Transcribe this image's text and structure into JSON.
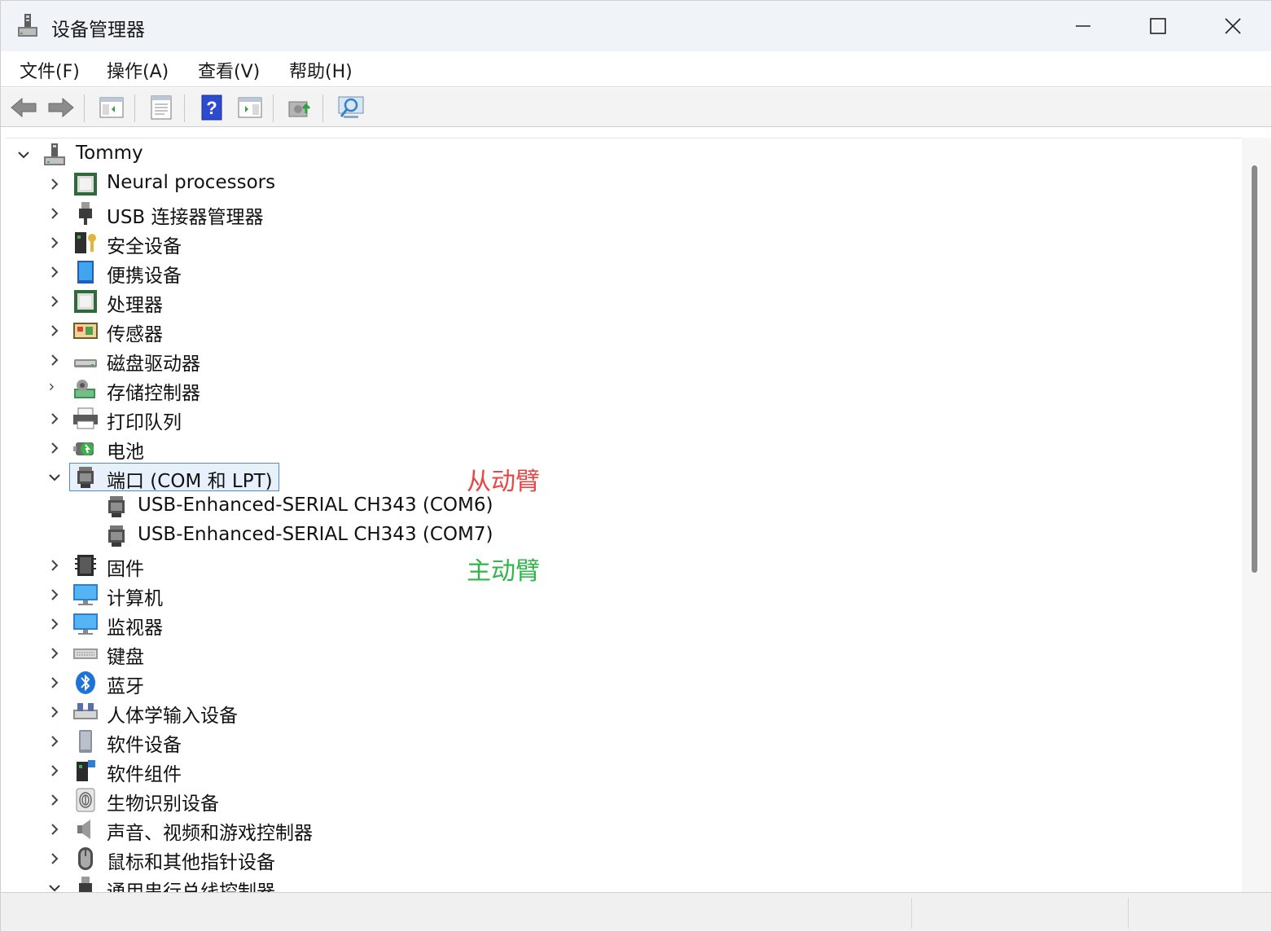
{
  "window": {
    "title": "设备管理器",
    "icon": "device-manager-icon"
  },
  "menu": [
    {
      "label": "文件(F)"
    },
    {
      "label": "操作(A)"
    },
    {
      "label": "查看(V)"
    },
    {
      "label": "帮助(H)"
    }
  ],
  "toolbar": [
    {
      "name": "back-icon"
    },
    {
      "name": "forward-icon"
    },
    {
      "name": "show-hide-console-tree-icon"
    },
    {
      "name": "properties-icon"
    },
    {
      "name": "help-icon"
    },
    {
      "name": "show-action-pane-icon"
    },
    {
      "name": "update-driver-icon"
    },
    {
      "name": "scan-hardware-icon"
    }
  ],
  "tree": {
    "root": {
      "label": "Tommy",
      "icon": "computer-tower-icon",
      "expanded": true
    },
    "categories": [
      {
        "label": "Neural processors",
        "icon": "npu-chip-icon",
        "expanded": false
      },
      {
        "label": "USB 连接器管理器",
        "icon": "usb-plug-icon",
        "expanded": false
      },
      {
        "label": "安全设备",
        "icon": "security-key-icon",
        "expanded": false
      },
      {
        "label": "便携设备",
        "icon": "portable-device-icon",
        "expanded": false
      },
      {
        "label": "处理器",
        "icon": "processor-chip-icon",
        "expanded": false
      },
      {
        "label": "传感器",
        "icon": "sensor-icon",
        "expanded": false
      },
      {
        "label": "磁盘驱动器",
        "icon": "disk-drive-icon",
        "expanded": false
      },
      {
        "label": "存储控制器",
        "icon": "storage-controller-icon",
        "expanded": false
      },
      {
        "label": "打印队列",
        "icon": "printer-icon",
        "expanded": false
      },
      {
        "label": "电池",
        "icon": "battery-icon",
        "expanded": false
      },
      {
        "label": "端口 (COM 和 LPT)",
        "icon": "port-connector-icon",
        "expanded": true,
        "selected": true,
        "children": [
          {
            "label": "USB-Enhanced-SERIAL CH343 (COM6)",
            "icon": "port-connector-icon"
          },
          {
            "label": "USB-Enhanced-SERIAL CH343 (COM7)",
            "icon": "port-connector-icon"
          }
        ]
      },
      {
        "label": "固件",
        "icon": "firmware-chip-icon",
        "expanded": false
      },
      {
        "label": "计算机",
        "icon": "monitor-icon",
        "expanded": false
      },
      {
        "label": "监视器",
        "icon": "monitor-icon",
        "expanded": false
      },
      {
        "label": "键盘",
        "icon": "keyboard-icon",
        "expanded": false
      },
      {
        "label": "蓝牙",
        "icon": "bluetooth-icon",
        "expanded": false
      },
      {
        "label": "人体学输入设备",
        "icon": "hid-icon",
        "expanded": false
      },
      {
        "label": "软件设备",
        "icon": "software-device-icon",
        "expanded": false
      },
      {
        "label": "软件组件",
        "icon": "software-component-icon",
        "expanded": false
      },
      {
        "label": "生物识别设备",
        "icon": "fingerprint-icon",
        "expanded": false
      },
      {
        "label": "声音、视频和游戏控制器",
        "icon": "speaker-icon",
        "expanded": false
      },
      {
        "label": "鼠标和其他指针设备",
        "icon": "mouse-icon",
        "expanded": false
      },
      {
        "label": "通用串行总线控制器",
        "icon": "usb-plug-icon",
        "expanded": true
      }
    ]
  },
  "annotations": [
    {
      "text": "从动臂",
      "color": "#e84646"
    },
    {
      "text": "主动臂",
      "color": "#2fb54a"
    }
  ]
}
